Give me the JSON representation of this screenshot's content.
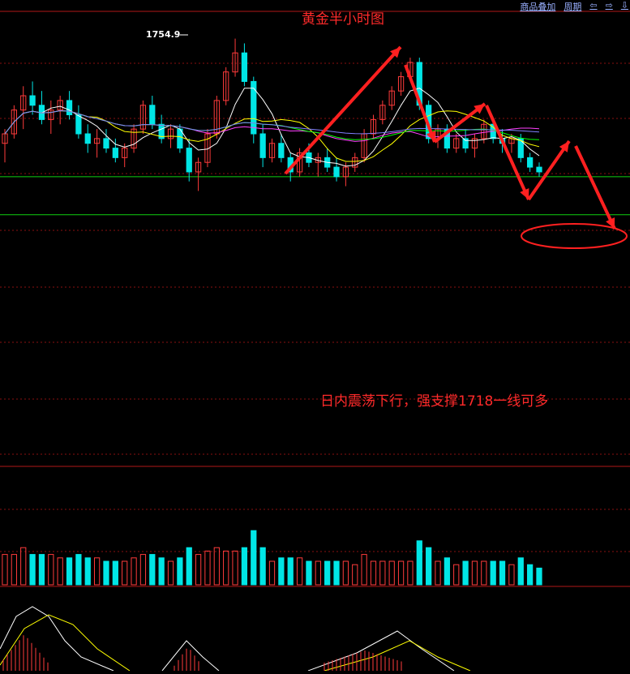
{
  "header": {
    "title": "黄金半小时图",
    "toolbar": [
      "商品叠加",
      "周期",
      "⇦",
      "⇨",
      "⇩"
    ]
  },
  "annotation": {
    "peak_label": "1754.9",
    "note": "日内震荡下行，强支撑1718一线可多"
  },
  "colors": {
    "up": "#ff3b3b",
    "down": "#00e6e6",
    "ma5": "#ffffff",
    "ma10": "#ffff00",
    "ma20": "#ff40ff",
    "ma30": "#00ff00",
    "ma60": "#8080ff",
    "arrow": "#ff2020"
  },
  "chart_data": {
    "type": "candlestick",
    "title": "黄金半小时图",
    "max_label": "1754.9",
    "ylim": [
      1712,
      1758
    ],
    "support_lines": [
      1726,
      1718
    ],
    "candles": [
      [
        1733,
        1736,
        1729,
        1735
      ],
      [
        1735,
        1741,
        1734,
        1740
      ],
      [
        1740,
        1745,
        1736,
        1743
      ],
      [
        1743,
        1746,
        1739,
        1741
      ],
      [
        1741,
        1744,
        1737,
        1738
      ],
      [
        1738,
        1742,
        1735,
        1740
      ],
      [
        1740,
        1743,
        1737,
        1742
      ],
      [
        1742,
        1744,
        1738,
        1739
      ],
      [
        1739,
        1741,
        1734,
        1735
      ],
      [
        1735,
        1737,
        1731,
        1733
      ],
      [
        1733,
        1736,
        1730,
        1734
      ],
      [
        1734,
        1736,
        1731,
        1732
      ],
      [
        1732,
        1734,
        1729,
        1730
      ],
      [
        1730,
        1733,
        1728,
        1732
      ],
      [
        1732,
        1737,
        1731,
        1736
      ],
      [
        1736,
        1742,
        1735,
        1741
      ],
      [
        1741,
        1743,
        1736,
        1737
      ],
      [
        1737,
        1739,
        1733,
        1734
      ],
      [
        1734,
        1737,
        1732,
        1736
      ],
      [
        1736,
        1737,
        1731,
        1732
      ],
      [
        1732,
        1734,
        1725,
        1727
      ],
      [
        1727,
        1730,
        1723,
        1729
      ],
      [
        1729,
        1736,
        1728,
        1735
      ],
      [
        1735,
        1743,
        1734,
        1742
      ],
      [
        1742,
        1749,
        1741,
        1748
      ],
      [
        1748,
        1755,
        1747,
        1752
      ],
      [
        1752,
        1754,
        1745,
        1746
      ],
      [
        1746,
        1747,
        1733,
        1735
      ],
      [
        1735,
        1737,
        1728,
        1730
      ],
      [
        1730,
        1734,
        1729,
        1733
      ],
      [
        1733,
        1735,
        1729,
        1730
      ],
      [
        1730,
        1731,
        1725,
        1727
      ],
      [
        1727,
        1732,
        1726,
        1731
      ],
      [
        1731,
        1733,
        1728,
        1729
      ],
      [
        1729,
        1731,
        1726,
        1730
      ],
      [
        1730,
        1732,
        1727,
        1728
      ],
      [
        1728,
        1730,
        1725,
        1726
      ],
      [
        1726,
        1729,
        1724,
        1728
      ],
      [
        1728,
        1731,
        1727,
        1730
      ],
      [
        1730,
        1736,
        1729,
        1735
      ],
      [
        1735,
        1739,
        1734,
        1738
      ],
      [
        1738,
        1742,
        1737,
        1741
      ],
      [
        1741,
        1745,
        1740,
        1744
      ],
      [
        1744,
        1748,
        1743,
        1747
      ],
      [
        1747,
        1751,
        1746,
        1750
      ],
      [
        1750,
        1751,
        1740,
        1741
      ],
      [
        1741,
        1742,
        1733,
        1734
      ],
      [
        1734,
        1737,
        1732,
        1736
      ],
      [
        1736,
        1737,
        1731,
        1732
      ],
      [
        1732,
        1735,
        1731,
        1734
      ],
      [
        1734,
        1736,
        1731,
        1732
      ],
      [
        1732,
        1735,
        1730,
        1734
      ],
      [
        1734,
        1738,
        1733,
        1737
      ],
      [
        1737,
        1738,
        1733,
        1734
      ],
      [
        1734,
        1736,
        1731,
        1733
      ],
      [
        1733,
        1735,
        1731,
        1734
      ],
      [
        1734,
        1735,
        1729,
        1730
      ],
      [
        1730,
        1731,
        1727,
        1728
      ],
      [
        1728,
        1729,
        1726,
        1727
      ]
    ],
    "volume_panel": true,
    "macd_panel": true
  }
}
